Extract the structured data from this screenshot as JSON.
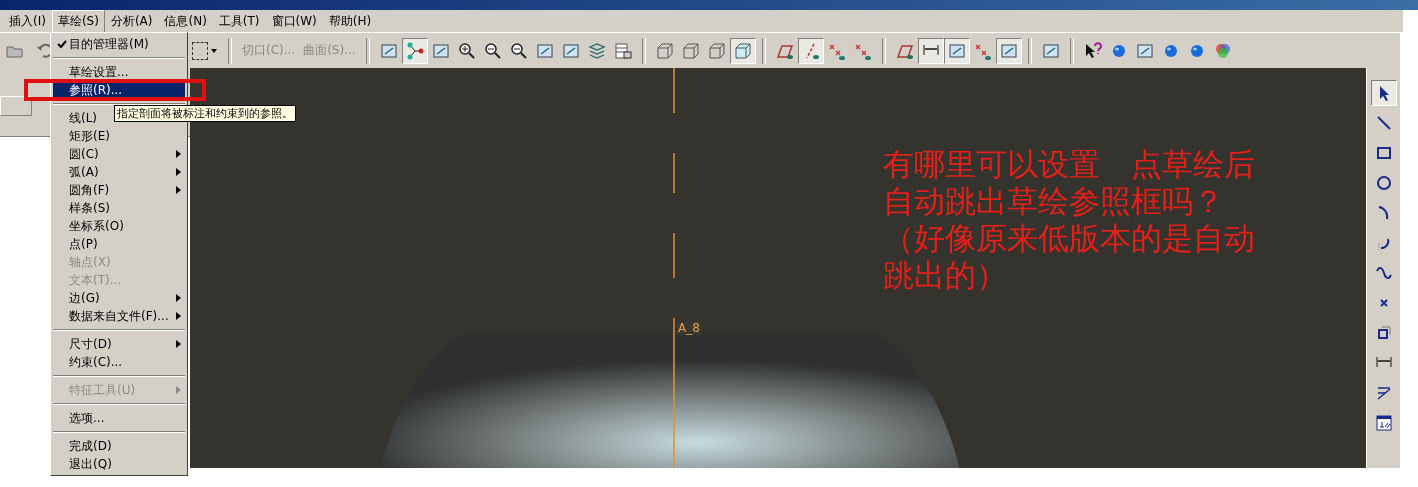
{
  "menubar": [
    {
      "label": "插入(I)",
      "selected": false
    },
    {
      "label": "草绘(S)",
      "selected": true
    },
    {
      "label": "分析(A)",
      "selected": false
    },
    {
      "label": "信息(N)",
      "selected": false
    },
    {
      "label": "工具(T)",
      "selected": false
    },
    {
      "label": "窗口(W)",
      "selected": false
    },
    {
      "label": "帮助(H)",
      "selected": false
    }
  ],
  "toolbar": {
    "left_buttons": [
      {
        "pressed": false
      },
      {
        "pressed": false
      }
    ],
    "items": [
      {
        "kind": "dropdown",
        "pressed": false
      },
      {
        "kind": "separator"
      },
      {
        "kind": "text",
        "label": "切口(C)...",
        "disabled": true
      },
      {
        "kind": "text",
        "label": "曲面(S)...",
        "disabled": true
      },
      {
        "kind": "separator"
      },
      {
        "kind": "icon",
        "pressed": false
      },
      {
        "kind": "icon",
        "pressed": true
      },
      {
        "kind": "icon",
        "pressed": false
      },
      {
        "kind": "icon",
        "pressed": false
      },
      {
        "kind": "icon",
        "pressed": false
      },
      {
        "kind": "icon",
        "pressed": false
      },
      {
        "kind": "icon",
        "pressed": false
      },
      {
        "kind": "icon",
        "pressed": false
      },
      {
        "kind": "icon",
        "pressed": false
      },
      {
        "kind": "icon",
        "pressed": false
      },
      {
        "kind": "separator"
      },
      {
        "kind": "icon",
        "pressed": false
      },
      {
        "kind": "icon",
        "pressed": false
      },
      {
        "kind": "icon",
        "pressed": false
      },
      {
        "kind": "icon",
        "pressed": true
      },
      {
        "kind": "separator"
      },
      {
        "kind": "icon",
        "pressed": false
      },
      {
        "kind": "icon",
        "pressed": true
      },
      {
        "kind": "icon",
        "pressed": false
      },
      {
        "kind": "icon",
        "pressed": false
      },
      {
        "kind": "separator"
      },
      {
        "kind": "icon",
        "pressed": false
      },
      {
        "kind": "icon",
        "pressed": true
      },
      {
        "kind": "icon",
        "pressed": true
      },
      {
        "kind": "icon",
        "pressed": false
      },
      {
        "kind": "icon",
        "pressed": true
      },
      {
        "kind": "separator"
      },
      {
        "kind": "icon",
        "pressed": false
      },
      {
        "kind": "separator"
      },
      {
        "kind": "icon",
        "pressed": false
      },
      {
        "kind": "icon",
        "pressed": false
      },
      {
        "kind": "icon",
        "pressed": false
      },
      {
        "kind": "icon",
        "pressed": false
      },
      {
        "kind": "icon",
        "pressed": false
      },
      {
        "kind": "icon",
        "pressed": false
      }
    ]
  },
  "menu": [
    {
      "kind": "item",
      "label": "目的管理器(M)",
      "checked": true,
      "submenu": false,
      "disabled": false,
      "selected": false
    },
    {
      "kind": "separator"
    },
    {
      "kind": "item",
      "label": "草绘设置...",
      "checked": false,
      "submenu": false,
      "disabled": false,
      "selected": false
    },
    {
      "kind": "item",
      "label": "参照(R)...",
      "checked": false,
      "submenu": false,
      "disabled": false,
      "selected": true
    },
    {
      "kind": "separator"
    },
    {
      "kind": "item",
      "label": "线(L)",
      "checked": false,
      "submenu": false,
      "disabled": false,
      "selected": false
    },
    {
      "kind": "item",
      "label": "矩形(E)",
      "checked": false,
      "submenu": false,
      "disabled": false,
      "selected": false
    },
    {
      "kind": "item",
      "label": "圆(C)",
      "checked": false,
      "submenu": true,
      "disabled": false,
      "selected": false
    },
    {
      "kind": "item",
      "label": "弧(A)",
      "checked": false,
      "submenu": true,
      "disabled": false,
      "selected": false
    },
    {
      "kind": "item",
      "label": "圆角(F)",
      "checked": false,
      "submenu": true,
      "disabled": false,
      "selected": false
    },
    {
      "kind": "item",
      "label": "样条(S)",
      "checked": false,
      "submenu": false,
      "disabled": false,
      "selected": false
    },
    {
      "kind": "item",
      "label": "坐标系(O)",
      "checked": false,
      "submenu": false,
      "disabled": false,
      "selected": false
    },
    {
      "kind": "item",
      "label": "点(P)",
      "checked": false,
      "submenu": false,
      "disabled": false,
      "selected": false
    },
    {
      "kind": "item",
      "label": "轴点(X)",
      "checked": false,
      "submenu": false,
      "disabled": true,
      "selected": false
    },
    {
      "kind": "item",
      "label": "文本(T)...",
      "checked": false,
      "submenu": false,
      "disabled": true,
      "selected": false
    },
    {
      "kind": "item",
      "label": "边(G)",
      "checked": false,
      "submenu": true,
      "disabled": false,
      "selected": false
    },
    {
      "kind": "item",
      "label": "数据来自文件(F)...",
      "checked": false,
      "submenu": true,
      "disabled": false,
      "selected": false
    },
    {
      "kind": "separator"
    },
    {
      "kind": "item",
      "label": "尺寸(D)",
      "checked": false,
      "submenu": true,
      "disabled": false,
      "selected": false
    },
    {
      "kind": "item",
      "label": "约束(C)...",
      "checked": false,
      "submenu": false,
      "disabled": false,
      "selected": false
    },
    {
      "kind": "separator"
    },
    {
      "kind": "item",
      "label": "特征工具(U)",
      "checked": false,
      "submenu": true,
      "disabled": true,
      "selected": false
    },
    {
      "kind": "separator"
    },
    {
      "kind": "item",
      "label": "选项...",
      "checked": false,
      "submenu": false,
      "disabled": false,
      "selected": false
    },
    {
      "kind": "separator"
    },
    {
      "kind": "item",
      "label": "完成(D)",
      "checked": false,
      "submenu": false,
      "disabled": false,
      "selected": false
    },
    {
      "kind": "item",
      "label": "退出(Q)",
      "checked": false,
      "submenu": false,
      "disabled": false,
      "selected": false
    }
  ],
  "tooltip": "指定剖面将被标注和约束到的参照。",
  "canvas": {
    "axis_label": "A_8",
    "annotation": [
      "有哪里可以设置　点草绘后",
      "自动跳出草绘参照框吗？",
      "（好像原来低版本的是自动",
      "跳出的）"
    ]
  },
  "sketch_toolbar": [
    {
      "pressed": true
    },
    {
      "pressed": false
    },
    {
      "pressed": false
    },
    {
      "pressed": false
    },
    {
      "pressed": false
    },
    {
      "pressed": false
    },
    {
      "pressed": false
    },
    {
      "pressed": false
    },
    {
      "pressed": false
    },
    {
      "pressed": false
    },
    {
      "pressed": false
    },
    {
      "pressed": false
    }
  ]
}
